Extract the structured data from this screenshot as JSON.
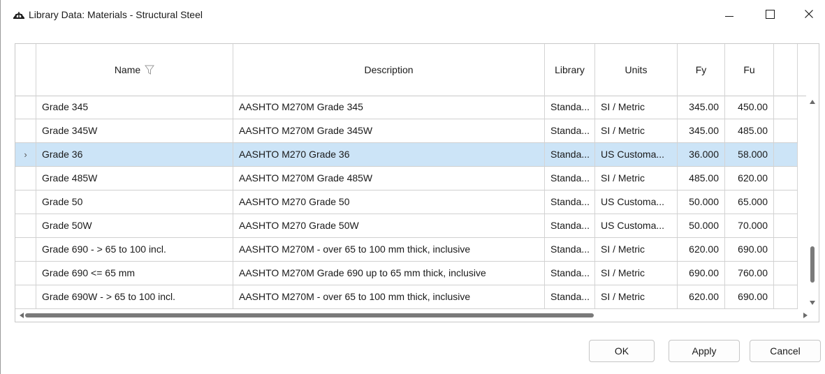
{
  "window": {
    "title": "Library Data: Materials - Structural Steel",
    "icon": "bridge-app-icon",
    "controls": {
      "minimize": "minimize-icon",
      "maximize": "maximize-icon",
      "close_glyph": "✕"
    }
  },
  "grid": {
    "columns": {
      "name": "Name",
      "description": "Description",
      "library": "Library",
      "units": "Units",
      "fy": "Fy",
      "fu": "Fu"
    },
    "name_filter_icon": "filter-icon",
    "current_row_marker": "›",
    "rows": [
      {
        "name": "Grade 345",
        "description": "AASHTO M270M Grade 345",
        "library": "Standa...",
        "units": "SI / Metric",
        "fy": "345.00",
        "fu": "450.00"
      },
      {
        "name": "Grade 345W",
        "description": "AASHTO M270M Grade 345W",
        "library": "Standa...",
        "units": "SI / Metric",
        "fy": "345.00",
        "fu": "485.00"
      },
      {
        "name": "Grade 36",
        "description": "AASHTO M270 Grade 36",
        "library": "Standa...",
        "units": "US Customa...",
        "fy": "36.000",
        "fu": "58.000"
      },
      {
        "name": "Grade 485W",
        "description": "AASHTO M270M Grade 485W",
        "library": "Standa...",
        "units": "SI / Metric",
        "fy": "485.00",
        "fu": "620.00"
      },
      {
        "name": "Grade 50",
        "description": "AASHTO M270 Grade 50",
        "library": "Standa...",
        "units": "US Customa...",
        "fy": "50.000",
        "fu": "65.000"
      },
      {
        "name": "Grade 50W",
        "description": "AASHTO M270 Grade 50W",
        "library": "Standa...",
        "units": "US Customa...",
        "fy": "50.000",
        "fu": "70.000"
      },
      {
        "name": "Grade 690 - > 65 to 100 incl.",
        "description": "AASHTO M270M - over 65 to 100 mm thick, inclusive",
        "library": "Standa...",
        "units": "SI / Metric",
        "fy": "620.00",
        "fu": "690.00"
      },
      {
        "name": "Grade 690 <= 65 mm",
        "description": "AASHTO M270M Grade 690 up to 65 mm thick, inclusive",
        "library": "Standa...",
        "units": "SI / Metric",
        "fy": "690.00",
        "fu": "760.00"
      },
      {
        "name": "Grade 690W - > 65 to 100 incl.",
        "description": "AASHTO M270M - over 65 to 100 mm thick, inclusive",
        "library": "Standa...",
        "units": "SI / Metric",
        "fy": "620.00",
        "fu": "690.00"
      }
    ],
    "selected_row": "Grade 36"
  },
  "buttons": {
    "ok": "OK",
    "apply": "Apply",
    "cancel": "Cancel"
  },
  "colors": {
    "selection": "#cce4f7",
    "grid_line": "#d4d4d4"
  }
}
